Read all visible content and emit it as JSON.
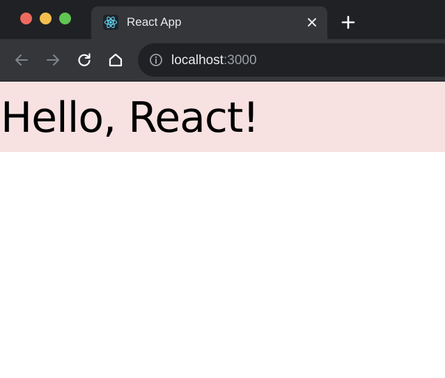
{
  "browser": {
    "tab": {
      "title": "React App",
      "favicon_icon": "react-logo-icon",
      "close_icon": "close-icon"
    },
    "new_tab_icon": "plus-icon",
    "toolbar": {
      "back_icon": "arrow-left-icon",
      "forward_icon": "arrow-right-icon",
      "reload_icon": "reload-icon",
      "home_icon": "home-icon"
    },
    "address": {
      "info_icon": "info-circle-icon",
      "host": "localhost",
      "port": ":3000"
    }
  },
  "page": {
    "heading": "Hello, React!",
    "header_background": "#f8e1e1"
  },
  "colors": {
    "tab_strip": "#202124",
    "toolbar": "#35363a",
    "react_blue": "#61dafb",
    "traffic_red": "#ed6a5e",
    "traffic_yellow": "#f5bf4f",
    "traffic_green": "#61c554"
  }
}
